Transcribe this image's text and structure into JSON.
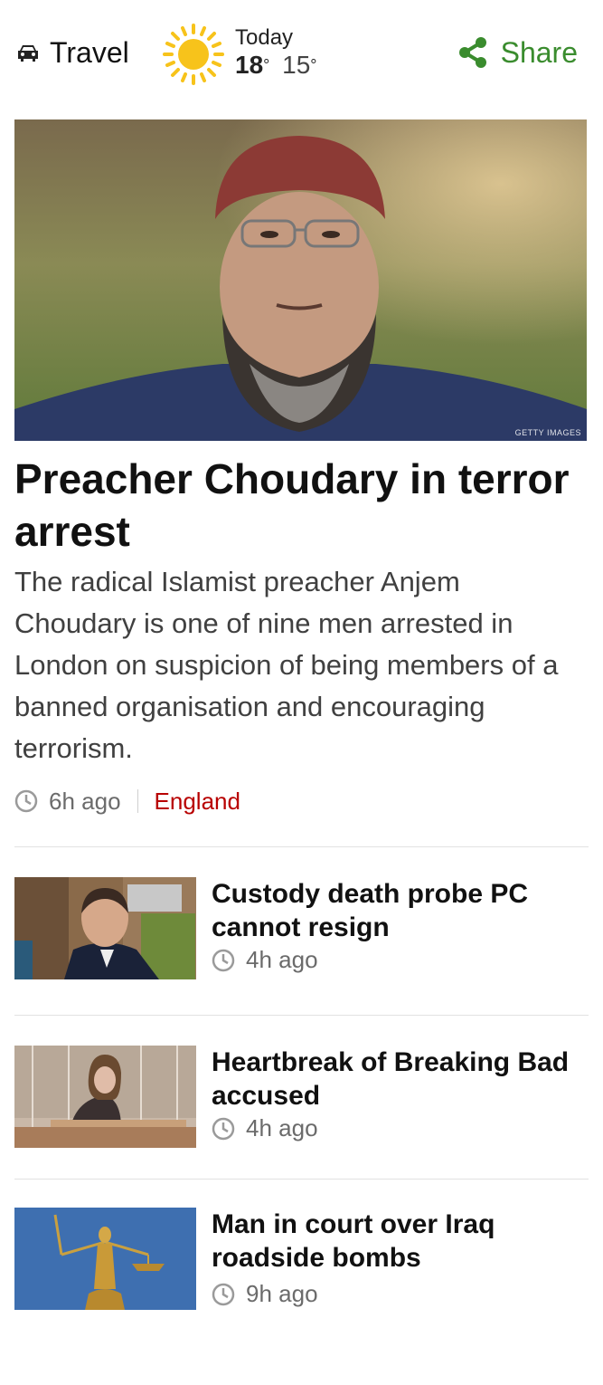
{
  "header": {
    "travel_label": "Travel",
    "travel_icon": "car-icon",
    "weather": {
      "icon": "sun-icon",
      "day": "Today",
      "high": "18",
      "low": "15",
      "degree": "°"
    },
    "share_label": "Share",
    "share_icon": "share-icon",
    "share_color": "#3a8c2e"
  },
  "lead_story": {
    "image_credit": "GETTY IMAGES",
    "headline": "Preacher Choudary in terror arrest",
    "summary": "The radical Islamist preacher Anjem Choudary is one of nine men arrested in London on suspicion of being members of a banned organisation and encouraging terrorism.",
    "time": "6h ago",
    "tag": "England",
    "tag_color": "#b80000"
  },
  "stories": [
    {
      "title": "Custody death probe PC cannot resign",
      "time": "4h ago"
    },
    {
      "title": "Heartbreak of Breaking Bad accused",
      "time": "4h ago"
    },
    {
      "title": "Man in court over Iraq roadside bombs",
      "time": "9h ago"
    }
  ]
}
